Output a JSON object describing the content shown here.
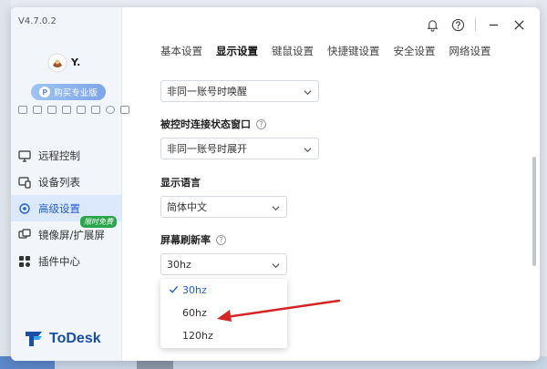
{
  "app": {
    "version": "V4.7.0.2",
    "username": "Y.",
    "pro_button": "购买专业版",
    "logo_text": "ToDesk"
  },
  "sidebar": {
    "items": [
      {
        "label": "远程控制",
        "icon": "monitor-icon",
        "active": false
      },
      {
        "label": "设备列表",
        "icon": "device-list-icon",
        "active": false
      },
      {
        "label": "高级设置",
        "icon": "settings-icon",
        "active": true
      },
      {
        "label": "镜像屏/扩展屏",
        "icon": "mirror-screen-icon",
        "active": false,
        "badge": "限时免费"
      },
      {
        "label": "插件中心",
        "icon": "plugin-icon",
        "active": false
      }
    ]
  },
  "tabs": [
    {
      "label": "基本设置",
      "active": false
    },
    {
      "label": "显示设置",
      "active": true
    },
    {
      "label": "键鼠设置",
      "active": false
    },
    {
      "label": "快捷键设置",
      "active": false
    },
    {
      "label": "安全设置",
      "active": false
    },
    {
      "label": "网络设置",
      "active": false
    }
  ],
  "settings": {
    "wake_select": "非同一账号时唤醒",
    "status_window_label": "被控时连接状态窗口",
    "status_window_select": "非同一账号时展开",
    "language_label": "显示语言",
    "language_select": "简体中文",
    "refresh_label": "屏幕刷新率",
    "refresh_select": "30hz"
  },
  "refresh_options": [
    {
      "label": "30hz",
      "selected": true
    },
    {
      "label": "60hz",
      "selected": false
    },
    {
      "label": "120hz",
      "selected": false
    }
  ],
  "colors": {
    "accent": "#1f5fd6",
    "annotation_arrow": "#d42424",
    "badge_green": "#2aa64a"
  }
}
